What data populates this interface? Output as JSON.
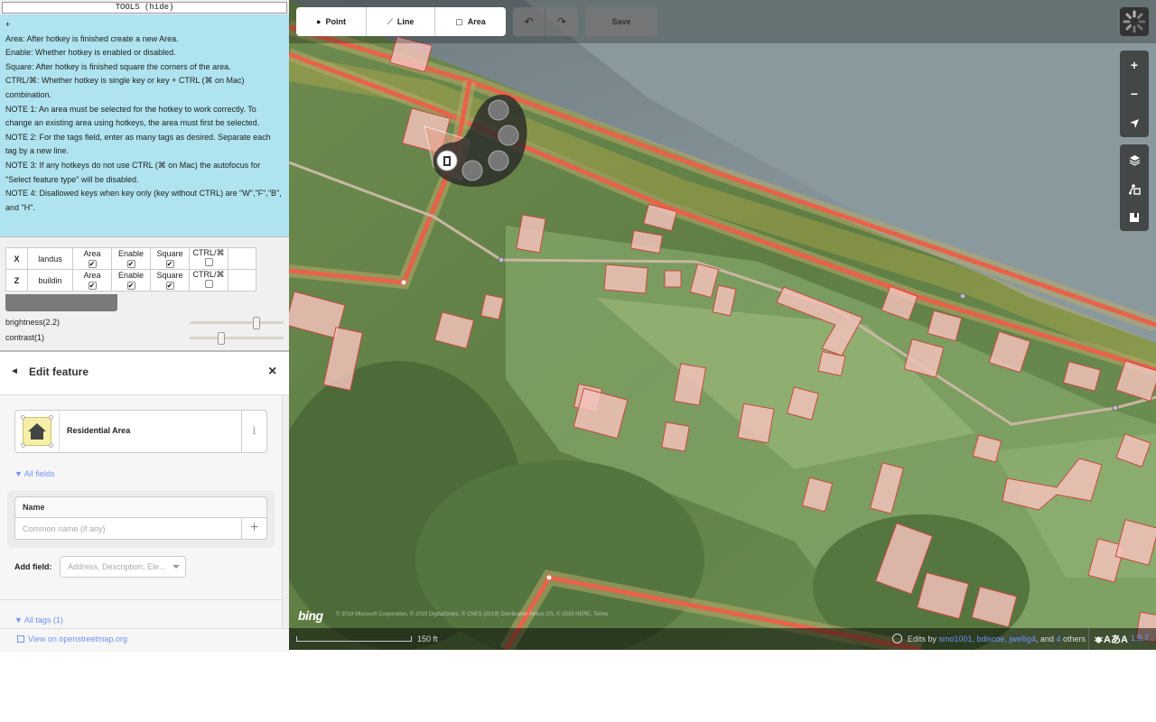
{
  "tools": {
    "toggle_label": "TOOLS (hide)",
    "help": {
      "marker": "+",
      "lines": [
        "Area: After hotkey is finished create a new Area.",
        "Enable: Whether hotkey is enabled or disabled.",
        "Square: After hotkey is finished square the corners of the area.",
        "CTRL/⌘: Whether hotkey is single key or key + CTRL (⌘ on Mac) combination.",
        "NOTE 1: An area must be selected for the hotkey to work correctly. To change an existing area using hotkeys, the area must first be selected.",
        "NOTE 2: For the tags field, enter as many tags as desired. Separate each tag by a new line.",
        "NOTE 3: If any hotkeys do not use CTRL (⌘ on Mac) the autofocus for \"Select feature type\" will be disabled.",
        "NOTE 4: Disallowed keys when key only (key without CTRL) are \"W\",\"F\",\"B\", and \"H\"."
      ]
    },
    "hotkeys": [
      {
        "key": "X",
        "tags": "landus",
        "area_label": "Area",
        "area": true,
        "enable_label": "Enable",
        "enable": true,
        "square_label": "Square",
        "square": true,
        "ctrl_label": "CTRL/⌘",
        "ctrl": false
      },
      {
        "key": "Z",
        "tags": "buildin",
        "area_label": "Area",
        "area": true,
        "enable_label": "Enable",
        "enable": true,
        "square_label": "Square",
        "square": true,
        "ctrl_label": "CTRL/⌘",
        "ctrl": false
      }
    ],
    "brightness_label": "brightness(2.2)",
    "brightness_value": 2.2,
    "contrast_label": "contrast(1)",
    "contrast_value": 1
  },
  "edit_panel": {
    "back_icon": "◄",
    "title": "Edit feature",
    "close_icon": "×",
    "preset_name": "Residential Area",
    "preset_info_icon": "i",
    "all_fields_label": "▼ All fields",
    "name_field_label": "Name",
    "name_value": "",
    "name_placeholder": "Common name (if any)",
    "name_add_icon": "+",
    "add_field_label": "Add field:",
    "add_field_placeholder": "Address, Description, Ele...",
    "all_tags_label": "▼ All tags (1)",
    "osm_link_label": "View on openstreetmap.org"
  },
  "map": {
    "modes": [
      {
        "label": "Point",
        "icon": "point-marker-icon"
      },
      {
        "label": "Line",
        "icon": "line-icon"
      },
      {
        "label": "Area",
        "icon": "area-icon"
      }
    ],
    "undo_icon": "↶",
    "redo_icon": "↷",
    "save_label": "Save",
    "zoom_in_icon": "+",
    "zoom_out_icon": "−",
    "bing_label": "bing",
    "imagery_attribution": "© 2019 Microsoft Corporation, © 2019 DigitalGlobe, © CNES (2019) Distribution Airbus DS, © 2019 HERE, Terms",
    "scale_label": "150 ft",
    "edits_prefix": "Edits by",
    "edits_users": "smo1001, bdiscoe, jwellig4",
    "edits_and": ", and",
    "edits_others_count": "4",
    "edits_others": "others",
    "issues_label": "AあA",
    "version": "1.9.7",
    "colors": {
      "road": "#e8624a",
      "road_casing": "#b9a96a",
      "building": "#f2c1ba",
      "building_stroke": "#c64a3f",
      "path": "#c9b7a2",
      "accent": "#7092ff"
    }
  }
}
